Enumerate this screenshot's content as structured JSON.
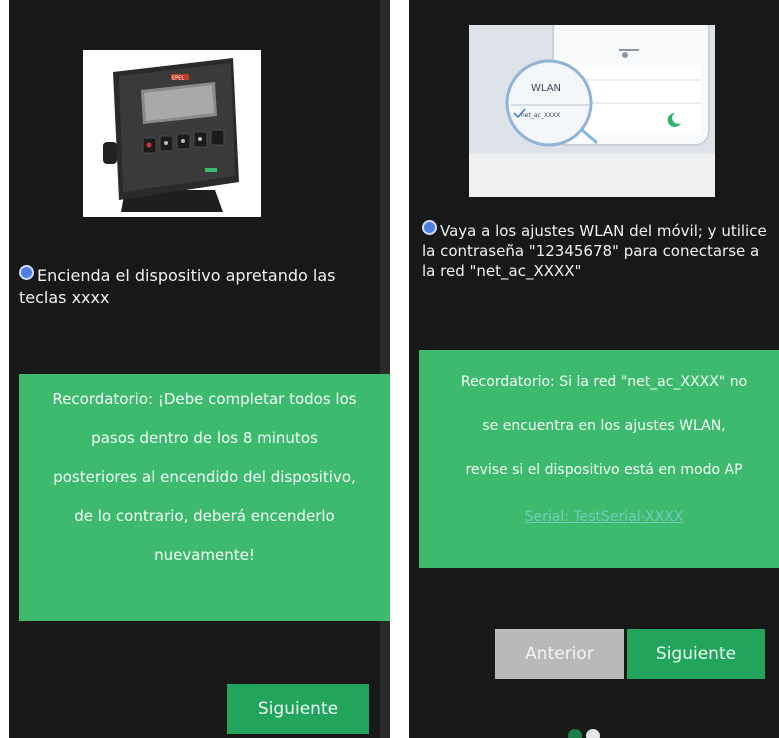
{
  "left": {
    "instruction": "Encienda el dispositivo apretando las teclas xxxx",
    "reminder_lines": [
      "Recordatorio: ¡Debe completar todos los",
      "pasos dentro de los 8 minutos",
      "posteriores al encendido del dispositivo,",
      "de lo contrario, deberá encenderlo",
      "nuevamente!"
    ],
    "next_label": "Siguiente",
    "device_logo": "EPEL"
  },
  "right": {
    "wlan_label": "WLAN",
    "network_chip": "net_ac_XXXX",
    "instruction": "Vaya a los ajustes WLAN del móvil; y utilice la contraseña \"12345678\" para conectarse a la red \"net_ac_XXXX\"",
    "reminder_lines": [
      "Recordatorio: Si la red \"net_ac_XXXX\" no",
      "se encuentra en los ajustes WLAN,",
      "revise si el dispositivo está en modo AP"
    ],
    "serial_link": "Serial: TestSerial-XXXX",
    "prev_label": "Anterior",
    "next_label": "Siguiente"
  },
  "colors": {
    "panel_bg": "#181818",
    "reminder_green": "#3dba6e",
    "button_green": "#23a45c",
    "button_grey": "#b9b9b9",
    "radio_blue": "#4f7fe0"
  }
}
